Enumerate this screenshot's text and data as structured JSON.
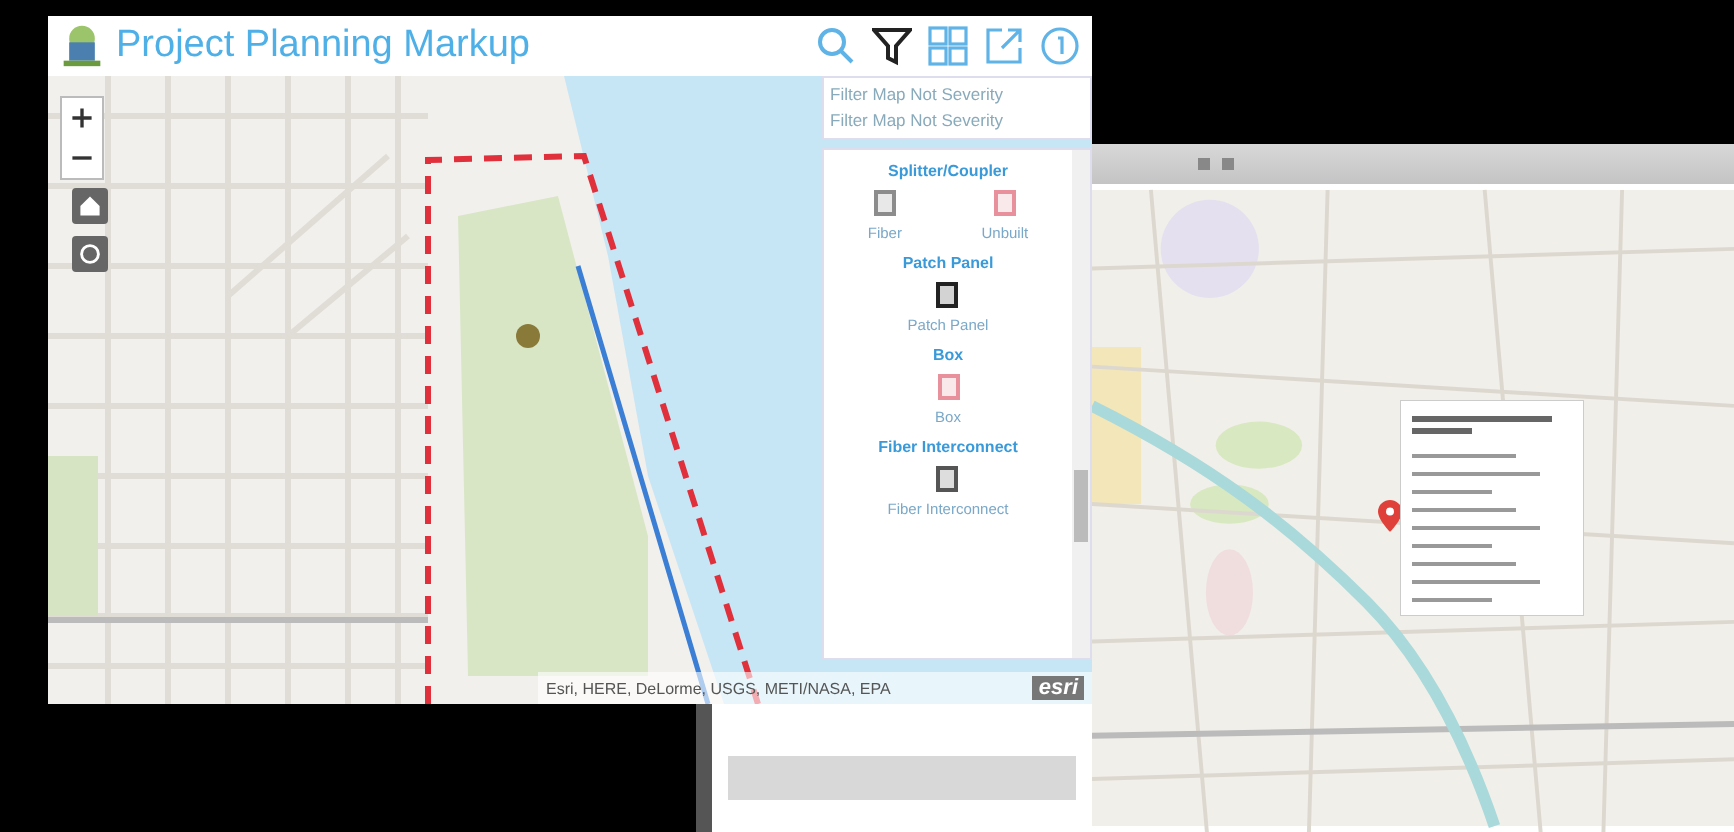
{
  "app": {
    "title": "Project Planning Markup"
  },
  "filters": [
    {
      "text": "Filter Map Not Severity"
    },
    {
      "text": "Filter Map Not Severity"
    }
  ],
  "layers": [
    {
      "heading": "Splitter/Coupler",
      "items": [
        {
          "label": "Fiber",
          "color": "#8c8c8c"
        },
        {
          "label": "Unbuilt",
          "color": "#e8909c"
        }
      ]
    },
    {
      "heading": "Patch Panel",
      "items": [
        {
          "label": "Patch Panel",
          "color": "#222222"
        }
      ]
    },
    {
      "heading": "Box",
      "items": [
        {
          "label": "Box",
          "color": "#e8909c"
        }
      ]
    },
    {
      "heading": "Fiber Interconnect",
      "items": [
        {
          "label": "Fiber Interconnect",
          "color": "#555555"
        }
      ]
    }
  ],
  "attribution": "Esri, HERE, DeLorme, USGS, METI/NASA, EPA",
  "logo": "esri"
}
